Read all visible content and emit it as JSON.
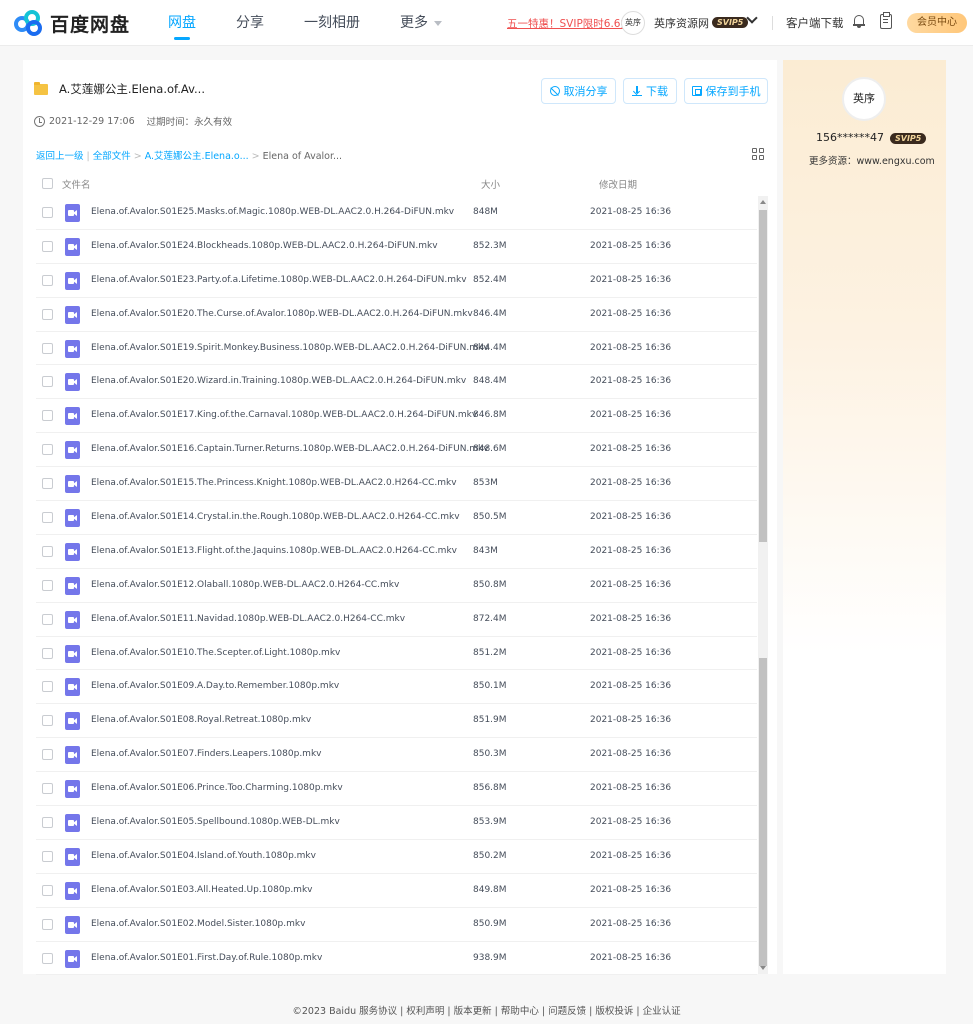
{
  "brand": {
    "name": "百度网盘"
  },
  "nav": {
    "items": [
      {
        "label": "网盘",
        "active": true
      },
      {
        "label": "分享"
      },
      {
        "label": "一刻相册"
      },
      {
        "label": "更多"
      }
    ]
  },
  "header": {
    "promo": "五一特惠！SVIP限时6.6折",
    "avatar_text": "英序",
    "username": "英序资源网",
    "badge": "SVIP5",
    "client_download": "客户端下载",
    "vip_center": "会员中心"
  },
  "share": {
    "folder_title": "A.艾莲娜公主.Elena.of.Av...",
    "created": "2021-12-29 17:06",
    "expire_label": "过期时间：永久有效",
    "buttons": {
      "cancel": "取消分享",
      "download": "下载",
      "save": "保存到手机"
    },
    "breadcrumb": {
      "back": "返回上一级",
      "all": "全部文件",
      "parent": "A.艾莲娜公主.Elena.o...",
      "current": "Elena of Avalor..."
    },
    "columns": {
      "name": "文件名",
      "size": "大小",
      "date": "修改日期"
    },
    "files": [
      {
        "name": "Elena.of.Avalor.S01E25.Masks.of.Magic.1080p.WEB-DL.AAC2.0.H.264-DiFUN.mkv",
        "size": "848M",
        "date": "2021-08-25 16:36"
      },
      {
        "name": "Elena.of.Avalor.S01E24.Blockheads.1080p.WEB-DL.AAC2.0.H.264-DiFUN.mkv",
        "size": "852.3M",
        "date": "2021-08-25 16:36"
      },
      {
        "name": "Elena.of.Avalor.S01E23.Party.of.a.Lifetime.1080p.WEB-DL.AAC2.0.H.264-DiFUN.mkv",
        "size": "852.4M",
        "date": "2021-08-25 16:36"
      },
      {
        "name": "Elena.of.Avalor.S01E20.The.Curse.of.Avalor.1080p.WEB-DL.AAC2.0.H.264-DiFUN.mkv",
        "size": "846.4M",
        "date": "2021-08-25 16:36"
      },
      {
        "name": "Elena.of.Avalor.S01E19.Spirit.Monkey.Business.1080p.WEB-DL.AAC2.0.H.264-DiFUN.mkv",
        "size": "844.4M",
        "date": "2021-08-25 16:36"
      },
      {
        "name": "Elena.of.Avalor.S01E20.Wizard.in.Training.1080p.WEB-DL.AAC2.0.H.264-DiFUN.mkv",
        "size": "848.4M",
        "date": "2021-08-25 16:36"
      },
      {
        "name": "Elena.of.Avalor.S01E17.King.of.the.Carnaval.1080p.WEB-DL.AAC2.0.H.264-DiFUN.mkv",
        "size": "846.8M",
        "date": "2021-08-25 16:36"
      },
      {
        "name": "Elena.of.Avalor.S01E16.Captain.Turner.Returns.1080p.WEB-DL.AAC2.0.H.264-DiFUN.mkv",
        "size": "848.6M",
        "date": "2021-08-25 16:36"
      },
      {
        "name": "Elena.of.Avalor.S01E15.The.Princess.Knight.1080p.WEB-DL.AAC2.0.H264-CC.mkv",
        "size": "853M",
        "date": "2021-08-25 16:36"
      },
      {
        "name": "Elena.of.Avalor.S01E14.Crystal.in.the.Rough.1080p.WEB-DL.AAC2.0.H264-CC.mkv",
        "size": "850.5M",
        "date": "2021-08-25 16:36"
      },
      {
        "name": "Elena.of.Avalor.S01E13.Flight.of.the.Jaquins.1080p.WEB-DL.AAC2.0.H264-CC.mkv",
        "size": "843M",
        "date": "2021-08-25 16:36"
      },
      {
        "name": "Elena.of.Avalor.S01E12.Olaball.1080p.WEB-DL.AAC2.0.H264-CC.mkv",
        "size": "850.8M",
        "date": "2021-08-25 16:36"
      },
      {
        "name": "Elena.of.Avalor.S01E11.Navidad.1080p.WEB-DL.AAC2.0.H264-CC.mkv",
        "size": "872.4M",
        "date": "2021-08-25 16:36"
      },
      {
        "name": "Elena.of.Avalor.S01E10.The.Scepter.of.Light.1080p.mkv",
        "size": "851.2M",
        "date": "2021-08-25 16:36"
      },
      {
        "name": "Elena.of.Avalor.S01E09.A.Day.to.Remember.1080p.mkv",
        "size": "850.1M",
        "date": "2021-08-25 16:36"
      },
      {
        "name": "Elena.of.Avalor.S01E08.Royal.Retreat.1080p.mkv",
        "size": "851.9M",
        "date": "2021-08-25 16:36"
      },
      {
        "name": "Elena.of.Avalor.S01E07.Finders.Leapers.1080p.mkv",
        "size": "850.3M",
        "date": "2021-08-25 16:36"
      },
      {
        "name": "Elena.of.Avalor.S01E06.Prince.Too.Charming.1080p.mkv",
        "size": "856.8M",
        "date": "2021-08-25 16:36"
      },
      {
        "name": "Elena.of.Avalor.S01E05.Spellbound.1080p.WEB-DL.mkv",
        "size": "853.9M",
        "date": "2021-08-25 16:36"
      },
      {
        "name": "Elena.of.Avalor.S01E04.Island.of.Youth.1080p.mkv",
        "size": "850.2M",
        "date": "2021-08-25 16:36"
      },
      {
        "name": "Elena.of.Avalor.S01E03.All.Heated.Up.1080p.mkv",
        "size": "849.8M",
        "date": "2021-08-25 16:36"
      },
      {
        "name": "Elena.of.Avalor.S01E02.Model.Sister.1080p.mkv",
        "size": "850.9M",
        "date": "2021-08-25 16:36"
      },
      {
        "name": "Elena.of.Avalor.S01E01.First.Day.of.Rule.1080p.mkv",
        "size": "938.9M",
        "date": "2021-08-25 16:36"
      }
    ]
  },
  "sidebar": {
    "avatar_text": "英序",
    "user_id": "156******47",
    "badge": "SVIP5",
    "more": "更多资源：www.engxu.com"
  },
  "footer": {
    "text": "©2023 Baidu  服务协议 | 权利声明 | 版本更新 | 帮助中心 | 问题反馈 | 版权投诉 | 企业认证"
  },
  "colors": {
    "accent": "#06a7ff",
    "video_icon": "#7476ea",
    "folder": "#f5c343",
    "promo": "#ef4f4f"
  }
}
